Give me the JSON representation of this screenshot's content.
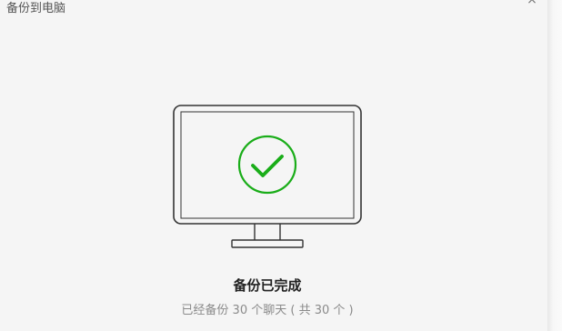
{
  "window": {
    "title": "备份到电脑",
    "close_label": "×"
  },
  "status": {
    "title": "备份已完成",
    "detail": "已经备份 30 个聊天 ( 共 30 个 )"
  },
  "colors": {
    "accent": "#1aad19",
    "monitor_stroke": "#333333",
    "background": "#f5f5f5"
  },
  "icons": {
    "illustration": "monitor-icon",
    "status": "check-circle-icon"
  }
}
